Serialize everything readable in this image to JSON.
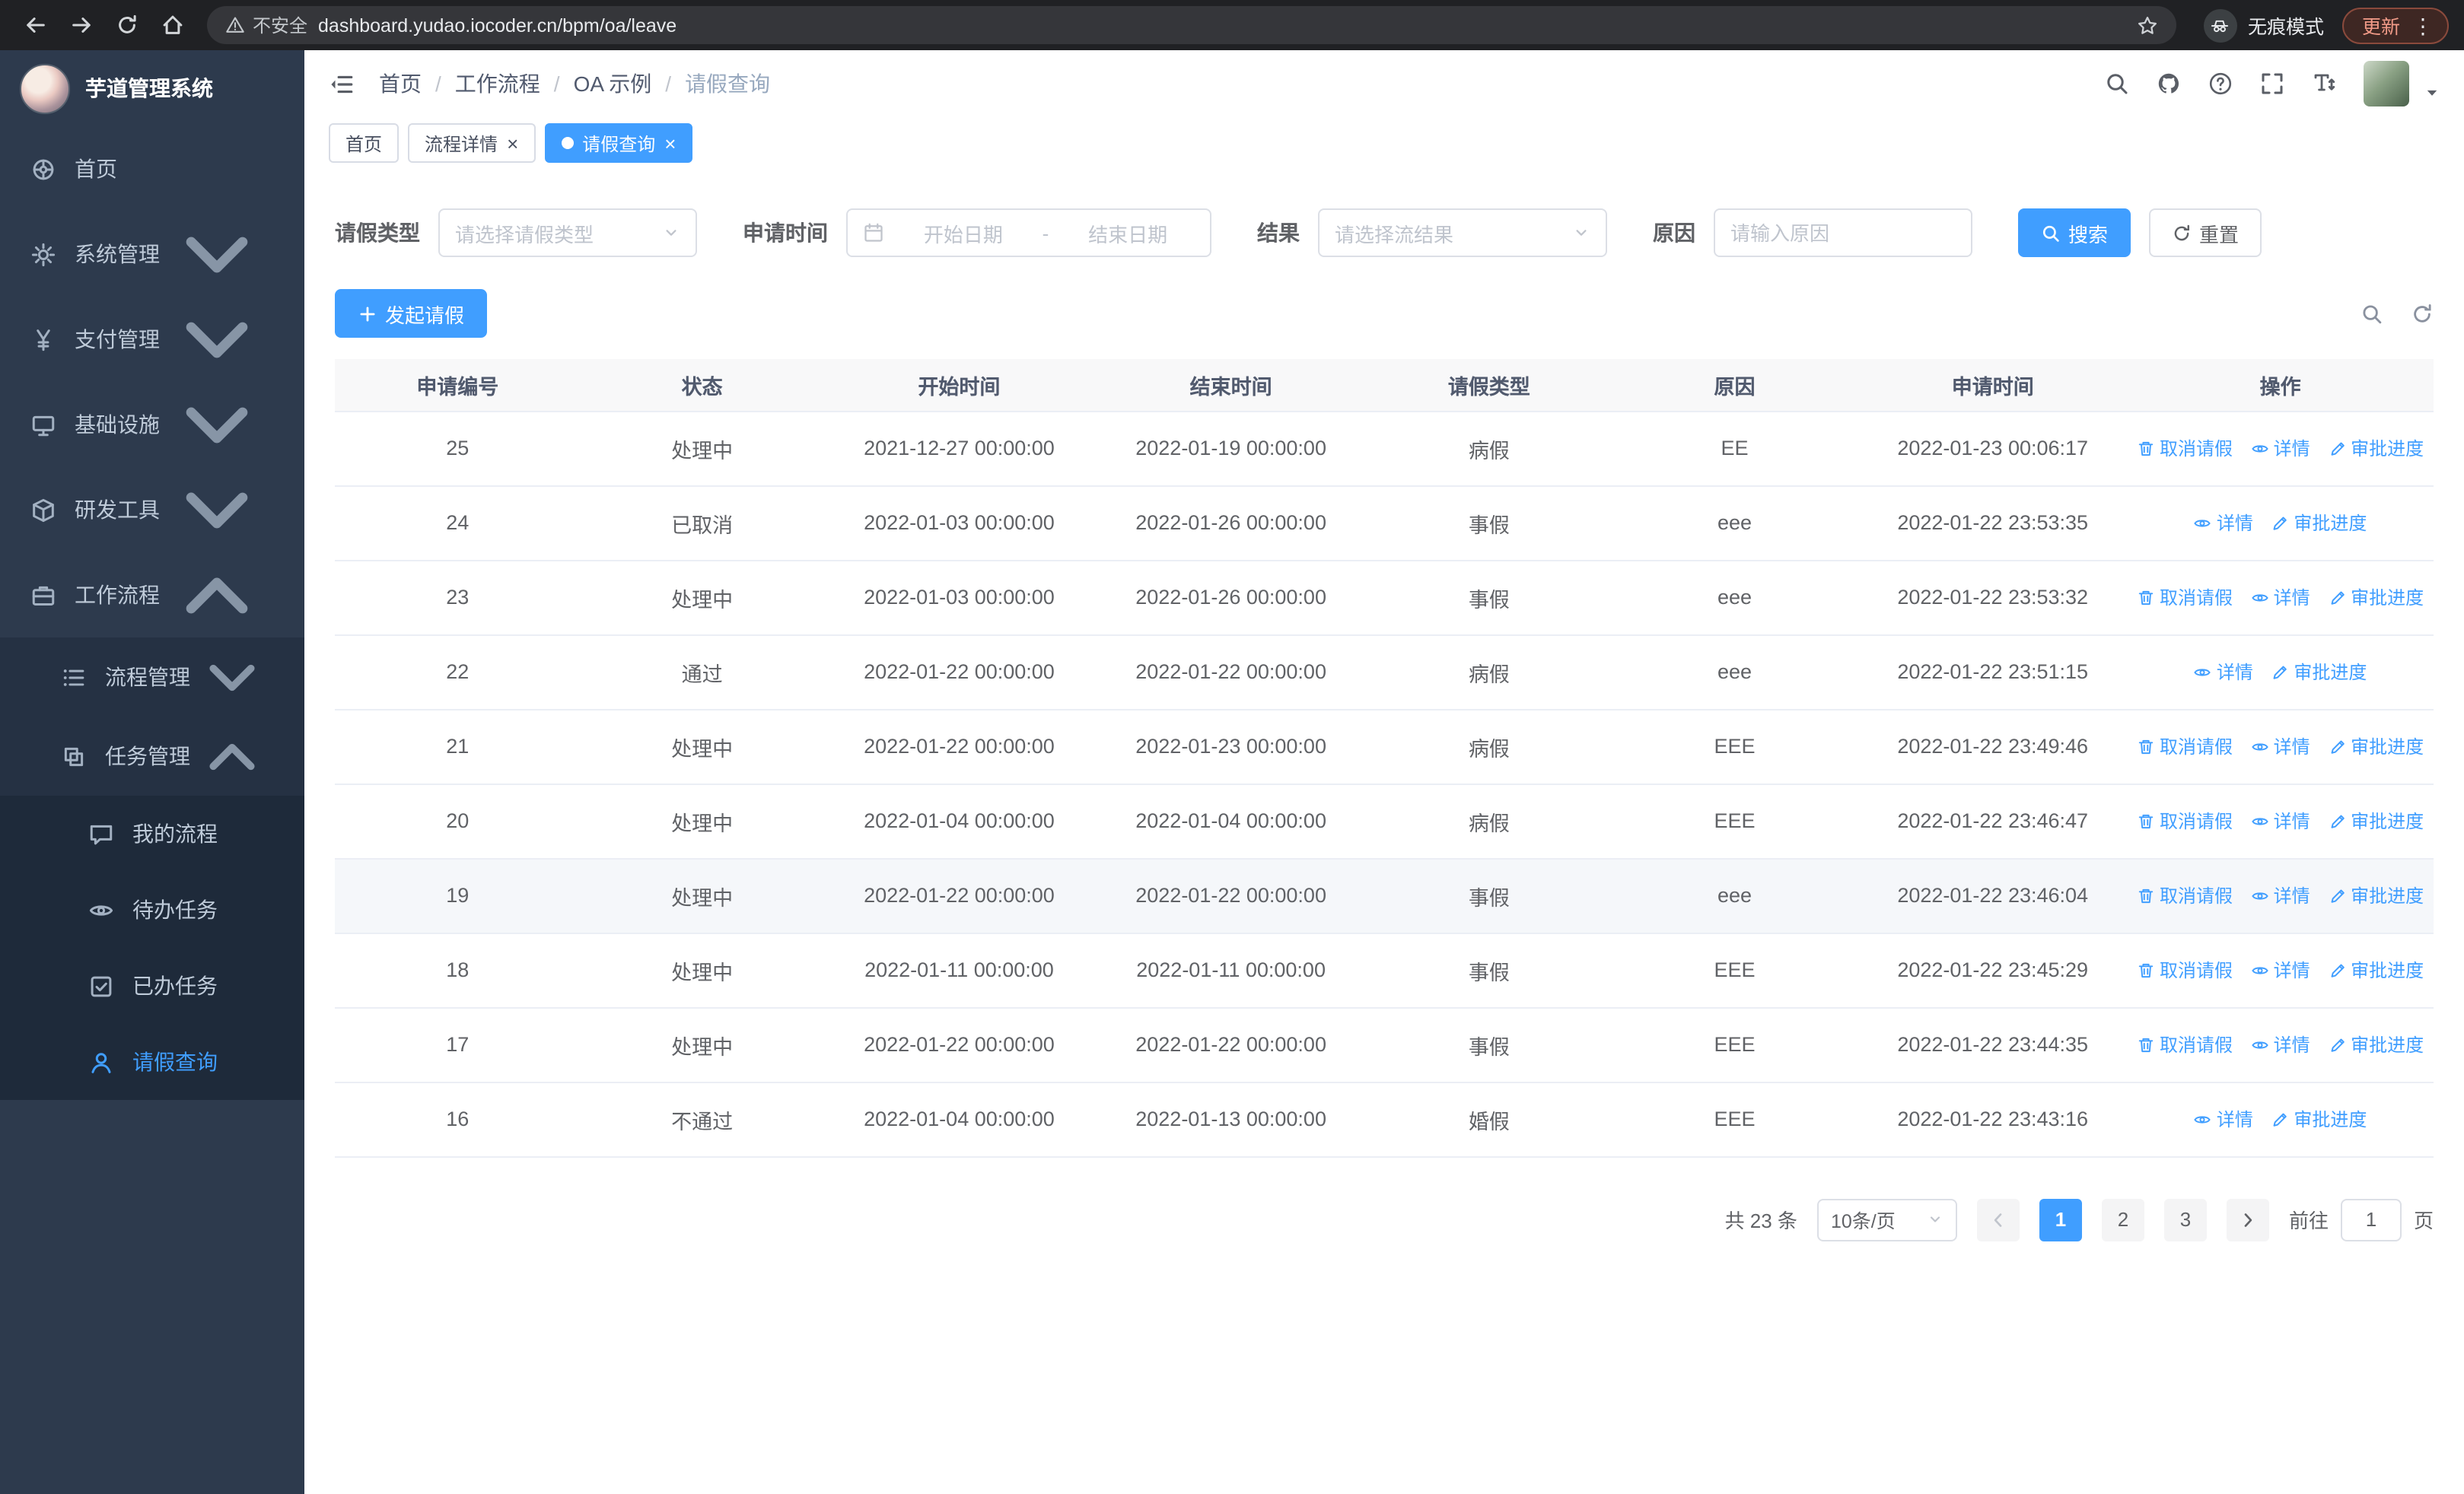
{
  "colors": {
    "accent": "#409eff",
    "sidebar_bg": "#2d3a4d",
    "sidebar_sub_bg": "#253143",
    "sidebar_sub2_bg": "#1e2a3a",
    "chrome_bg": "#202124",
    "table_header_bg": "#f8f8f9",
    "update_chip_text": "#f29b88"
  },
  "browser": {
    "security_label": "不安全",
    "url": "dashboard.yudao.iocoder.cn/bpm/oa/leave",
    "incognito_label": "无痕模式",
    "update_label": "更新"
  },
  "sidebar": {
    "logo_title": "芋道管理系统",
    "items": [
      {
        "label": "首页",
        "icon": "home"
      },
      {
        "label": "系统管理",
        "icon": "gear",
        "chevron": "down"
      },
      {
        "label": "支付管理",
        "icon": "yen",
        "chevron": "down"
      },
      {
        "label": "基础设施",
        "icon": "infra",
        "chevron": "down"
      },
      {
        "label": "研发工具",
        "icon": "tools",
        "chevron": "down"
      },
      {
        "label": "工作流程",
        "icon": "workflow",
        "chevron": "up"
      }
    ],
    "workflow_children": [
      {
        "label": "流程管理",
        "icon": "list",
        "chevron": "down"
      },
      {
        "label": "任务管理",
        "icon": "tasks",
        "chevron": "up"
      }
    ],
    "task_children": [
      {
        "label": "我的流程",
        "icon": "chat"
      },
      {
        "label": "待办任务",
        "icon": "eye"
      },
      {
        "label": "已办任务",
        "icon": "done"
      },
      {
        "label": "请假查询",
        "icon": "user",
        "active": true
      }
    ]
  },
  "header": {
    "breadcrumb": [
      {
        "label": "首页"
      },
      {
        "label": "工作流程"
      },
      {
        "label": "OA 示例"
      },
      {
        "label": "请假查询",
        "current": true
      }
    ]
  },
  "tabs": [
    {
      "label": "首页"
    },
    {
      "label": "流程详情",
      "closable": true
    },
    {
      "label": "请假查询",
      "closable": true,
      "active": true
    }
  ],
  "filters": {
    "leave_type_label": "请假类型",
    "leave_type_placeholder": "请选择请假类型",
    "apply_time_label": "申请时间",
    "date_start_placeholder": "开始日期",
    "date_separator": "-",
    "date_end_placeholder": "结束日期",
    "result_label": "结果",
    "result_placeholder": "请选择流结果",
    "reason_label": "原因",
    "reason_placeholder": "请输入原因",
    "search_button": "搜索",
    "reset_button": "重置"
  },
  "toolbar": {
    "create_label": "发起请假"
  },
  "table": {
    "columns": [
      {
        "label": "申请编号"
      },
      {
        "label": "状态"
      },
      {
        "label": "开始时间"
      },
      {
        "label": "结束时间"
      },
      {
        "label": "请假类型"
      },
      {
        "label": "原因"
      },
      {
        "label": "申请时间"
      },
      {
        "label": "操作"
      }
    ],
    "action_labels": {
      "cancel": "取消请假",
      "detail": "详情",
      "progress": "审批进度"
    },
    "rows": [
      {
        "id": "25",
        "status": "处理中",
        "start": "2021-12-27 00:00:00",
        "end": "2022-01-19 00:00:00",
        "type": "病假",
        "reason": "EE",
        "applied": "2022-01-23 00:06:17",
        "can_cancel": true
      },
      {
        "id": "24",
        "status": "已取消",
        "start": "2022-01-03 00:00:00",
        "end": "2022-01-26 00:00:00",
        "type": "事假",
        "reason": "eee",
        "applied": "2022-01-22 23:53:35"
      },
      {
        "id": "23",
        "status": "处理中",
        "start": "2022-01-03 00:00:00",
        "end": "2022-01-26 00:00:00",
        "type": "事假",
        "reason": "eee",
        "applied": "2022-01-22 23:53:32",
        "can_cancel": true
      },
      {
        "id": "22",
        "status": "通过",
        "start": "2022-01-22 00:00:00",
        "end": "2022-01-22 00:00:00",
        "type": "病假",
        "reason": "eee",
        "applied": "2022-01-22 23:51:15"
      },
      {
        "id": "21",
        "status": "处理中",
        "start": "2022-01-22 00:00:00",
        "end": "2022-01-23 00:00:00",
        "type": "病假",
        "reason": "EEE",
        "applied": "2022-01-22 23:49:46",
        "can_cancel": true
      },
      {
        "id": "20",
        "status": "处理中",
        "start": "2022-01-04 00:00:00",
        "end": "2022-01-04 00:00:00",
        "type": "病假",
        "reason": "EEE",
        "applied": "2022-01-22 23:46:47",
        "can_cancel": true
      },
      {
        "id": "19",
        "status": "处理中",
        "start": "2022-01-22 00:00:00",
        "end": "2022-01-22 00:00:00",
        "type": "事假",
        "reason": "eee",
        "applied": "2022-01-22 23:46:04",
        "can_cancel": true,
        "hover": true
      },
      {
        "id": "18",
        "status": "处理中",
        "start": "2022-01-11 00:00:00",
        "end": "2022-01-11 00:00:00",
        "type": "事假",
        "reason": "EEE",
        "applied": "2022-01-22 23:45:29",
        "can_cancel": true
      },
      {
        "id": "17",
        "status": "处理中",
        "start": "2022-01-22 00:00:00",
        "end": "2022-01-22 00:00:00",
        "type": "事假",
        "reason": "EEE",
        "applied": "2022-01-22 23:44:35",
        "can_cancel": true
      },
      {
        "id": "16",
        "status": "不通过",
        "start": "2022-01-04 00:00:00",
        "end": "2022-01-13 00:00:00",
        "type": "婚假",
        "reason": "EEE",
        "applied": "2022-01-22 23:43:16"
      }
    ]
  },
  "pagination": {
    "total_label": "共 23 条",
    "page_size_label": "10条/页",
    "pages": [
      {
        "label": "1",
        "active": true
      },
      {
        "label": "2"
      },
      {
        "label": "3"
      }
    ],
    "goto_label": "前往",
    "goto_value": "1",
    "goto_unit": "页"
  }
}
